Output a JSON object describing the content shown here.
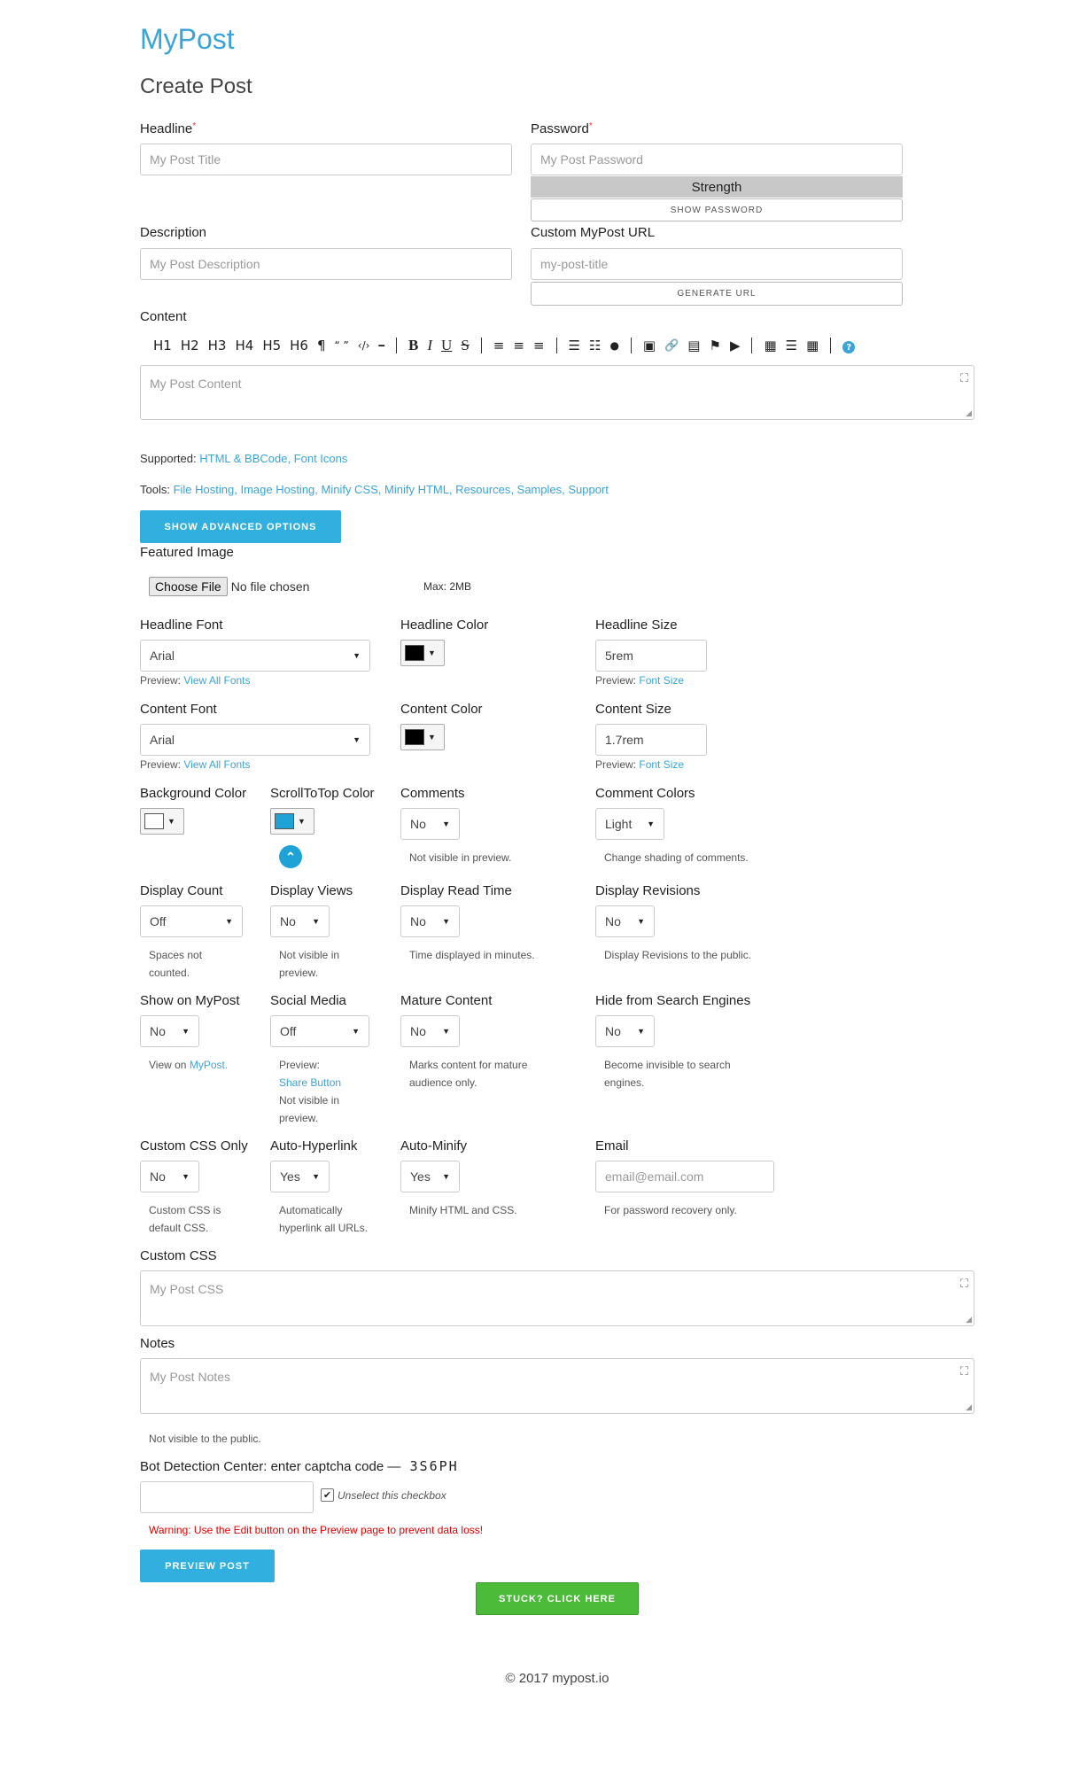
{
  "brand": "MyPost",
  "page_title": "Create Post",
  "headline": {
    "label": "Headline",
    "placeholder": "My Post Title"
  },
  "password": {
    "label": "Password",
    "placeholder": "My Post Password",
    "strength": "Strength",
    "show_button": "SHOW PASSWORD"
  },
  "description": {
    "label": "Description",
    "placeholder": "My Post Description"
  },
  "custom_url": {
    "label": "Custom MyPost URL",
    "placeholder": "my-post-title",
    "generate_button": "GENERATE URL"
  },
  "content": {
    "label": "Content",
    "placeholder": "My Post Content",
    "toolbar": {
      "headings": [
        "H1",
        "H2",
        "H3",
        "H4",
        "H5",
        "H6"
      ],
      "pilcrow": "¶",
      "quote": "“ ”",
      "code": "‹/›",
      "hr": "━",
      "bold": "B",
      "italic": "I",
      "underline": "U",
      "strike": "S",
      "align_center": "≡",
      "align_right": "≡",
      "justify": "≡",
      "ul": "☰",
      "ol": "☷",
      "dot": "●",
      "image": "▣",
      "link": "🔗",
      "file": "▤",
      "flag": "⚑",
      "youtube": "▶",
      "table": "▦",
      "list2": "☰",
      "grid": "▦",
      "help": "?"
    }
  },
  "supported": {
    "label": "Supported:",
    "links": "HTML & BBCode, Font Icons"
  },
  "tools": {
    "label": "Tools:",
    "links": "File Hosting, Image Hosting, Minify CSS, Minify HTML, Resources, Samples, Support"
  },
  "advanced_button": "SHOW ADVANCED OPTIONS",
  "featured_image": {
    "label": "Featured Image",
    "choose": "Choose File",
    "status": "No file chosen",
    "max": "Max: 2MB"
  },
  "headline_font": {
    "label": "Headline Font",
    "value": "Arial",
    "preview": "Preview:",
    "link": "View All Fonts"
  },
  "headline_color": {
    "label": "Headline Color",
    "color": "#000000"
  },
  "headline_size": {
    "label": "Headline Size",
    "value": "5rem",
    "preview": "Preview:",
    "link": "Font Size"
  },
  "content_font": {
    "label": "Content Font",
    "value": "Arial",
    "preview": "Preview:",
    "link": "View All Fonts"
  },
  "content_color": {
    "label": "Content Color",
    "color": "#000000"
  },
  "content_size": {
    "label": "Content Size",
    "value": "1.7rem",
    "preview": "Preview:",
    "link": "Font Size"
  },
  "background_color": {
    "label": "Background Color",
    "color": "#ffffff"
  },
  "scroll_color": {
    "label": "ScrollToTop Color",
    "color": "#1fa2d6"
  },
  "comments": {
    "label": "Comments",
    "value": "No",
    "hint": "Not visible in preview."
  },
  "comment_colors": {
    "label": "Comment Colors",
    "value": "Light",
    "hint": "Change shading of comments."
  },
  "display_count": {
    "label": "Display Count",
    "value": "Off",
    "hint": "Spaces not counted."
  },
  "display_views": {
    "label": "Display Views",
    "value": "No",
    "hint": "Not visible in preview."
  },
  "display_read_time": {
    "label": "Display Read Time",
    "value": "No",
    "hint": "Time displayed in minutes."
  },
  "display_revisions": {
    "label": "Display Revisions",
    "value": "No",
    "hint": "Display Revisions to the public."
  },
  "show_on_mypost": {
    "label": "Show on MyPost",
    "value": "No",
    "hint": "View on",
    "link": "MyPost."
  },
  "social_media": {
    "label": "Social Media",
    "value": "Off",
    "hint1": "Preview:",
    "link": "Share Button",
    "hint2": "Not visible in preview."
  },
  "mature_content": {
    "label": "Mature Content",
    "value": "No",
    "hint": "Marks content for mature audience only."
  },
  "hide_search": {
    "label": "Hide from Search Engines",
    "value": "No",
    "hint": "Become invisible to search engines."
  },
  "custom_css_only": {
    "label": "Custom CSS Only",
    "value": "No",
    "hint": "Custom CSS is default CSS."
  },
  "auto_hyperlink": {
    "label": "Auto-Hyperlink",
    "value": "Yes",
    "hint": "Automatically hyperlink all URLs."
  },
  "auto_minify": {
    "label": "Auto-Minify",
    "value": "Yes",
    "hint": "Minify HTML and CSS."
  },
  "email": {
    "label": "Email",
    "placeholder": "email@email.com",
    "hint": "For password recovery only."
  },
  "custom_css": {
    "label": "Custom CSS",
    "placeholder": "My Post CSS"
  },
  "notes": {
    "label": "Notes",
    "placeholder": "My Post Notes",
    "hint": "Not visible to the public."
  },
  "captcha": {
    "label": "Bot Detection Center: enter captcha code —",
    "code": "3S6PH",
    "checkbox_label": "Unselect this checkbox"
  },
  "warning": "Warning: Use the Edit button on the Preview page to prevent data loss!",
  "preview_button": "PREVIEW POST",
  "stuck_button": "STUCK? CLICK HERE",
  "footer": "© 2017 mypost.io",
  "colors": {
    "accent": "#31b0e0",
    "warning": "#e00000",
    "green": "#4cbb3a"
  }
}
